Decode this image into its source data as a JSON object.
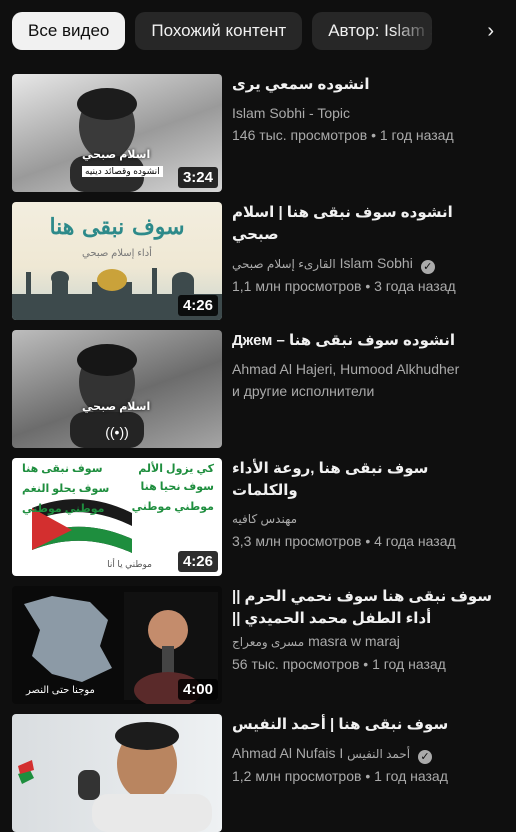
{
  "chips": {
    "all": "Все видео",
    "similar": "Похожий контент",
    "author": "Автор: Islam Sobhi"
  },
  "videos": [
    {
      "title": "انشوده سمعي يرى",
      "channel": "Islam Sobhi - Topic",
      "stats": "146 тыс. просмотров • 1 год назад",
      "duration": "3:24",
      "thumb_text": "اسلام صبحي",
      "thumb_caption": "انشوده وقصائد دينيه"
    },
    {
      "title": "انشوده سوف نبقى هنا | اسلام صبحي",
      "channel_prefix": "القارىء إسلام صبحي",
      "channel": "Islam Sobhi",
      "verified": "✓",
      "stats": "1,1 млн просмотров • 3 года назад",
      "duration": "4:26",
      "thumb_text": "سوف نبقى هنا",
      "thumb_caption": "أداء إسلام صبحي"
    },
    {
      "title": "Джем – انشوده سوف نبقى هنا",
      "channel": "Ahmad Al Hajeri, Humood Alkhudher",
      "channel_line2": "и другие исполнители",
      "thumb_text": "اسلام صبحي",
      "live_icon": "((•))"
    },
    {
      "title": "سوف نبقى هنا ,روعة الأداء والكلمات",
      "channel": "مهندس كافيه",
      "stats": "3,3 млн просмотров • 4 года назад",
      "duration": "4:26",
      "thumb_lines": [
        "سوف نبقى هنا",
        "كي يزول الألم",
        "سوف نحيا هنا",
        "سوف يحلو النغم",
        "موطني موطني",
        "موطني موطني",
        "موطني يا أنا"
      ]
    },
    {
      "title": "سوف نبقى هنا سوف نحمي الحرم || أداء الطفل محمد الحميدي || #سوف_نبقى_هنا ...",
      "channel": "masra w maraj",
      "channel_suffix": "مسرى ومعراج",
      "stats": "56 тыс. просмотров • 1 год назад",
      "duration": "4:00",
      "thumb_caption": "موجنا حتى النصر"
    },
    {
      "title": "سوف نبقى هنا | أحمد النفيس",
      "channel": "Ahmad Al Nufais I",
      "channel_suffix": "أحمد النفيس",
      "verified": "✓",
      "stats": "1,2 млн просмотров • 1 год назад"
    }
  ],
  "colors": {
    "background": "#0f0f0f",
    "chip": "#272727",
    "chip_active": "#f1f1f1",
    "secondary_text": "#aaaaaa"
  }
}
